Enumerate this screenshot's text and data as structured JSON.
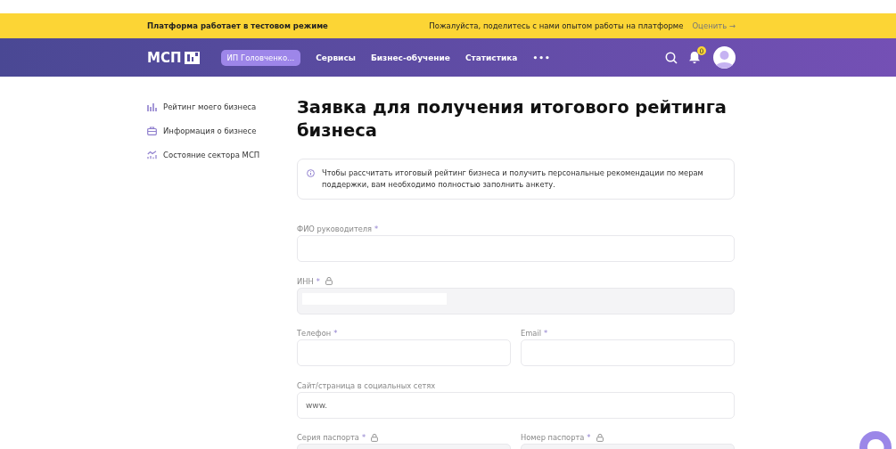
{
  "banner": {
    "text": "Платформа работает в тестовом режиме",
    "prompt": "Пожалуйста, поделитесь с нами опытом работы на платформе",
    "action": "Оценить",
    "arrow": "→"
  },
  "nav": {
    "logo": "МСП",
    "account": "ИП Головченко...",
    "links": [
      "Сервисы",
      "Бизнес-обучение",
      "Статистика"
    ],
    "more": "•••",
    "notifications": "0"
  },
  "sidebar": {
    "items": [
      {
        "label": "Рейтинг моего бизнеса"
      },
      {
        "label": "Информация о бизнесе"
      },
      {
        "label": "Состояние сектора МСП"
      }
    ]
  },
  "title": "Заявка для получения итогового рейтинга бизнеса",
  "notice": "Чтобы рассчитать итоговый рейтинг бизнеса и получить персональные рекомендации по мерам поддержки, вам необходимо полностью заполнить анкету.",
  "form": {
    "rows": [
      [
        {
          "label": "ФИО руководителя",
          "mark": "*",
          "locked": false,
          "disabled": false
        }
      ],
      [
        {
          "label": "ИНН",
          "mark": "*",
          "locked": true,
          "disabled": true,
          "redacted": true
        }
      ],
      [
        {
          "label": "Телефон",
          "mark": "*",
          "locked": false,
          "disabled": false
        },
        {
          "label": "Email",
          "mark": "*",
          "locked": false,
          "disabled": false
        }
      ],
      [
        {
          "label": "Сайт/страница в социальных сетях",
          "locked": false,
          "disabled": false,
          "placeholder": "www."
        }
      ],
      [
        {
          "label": "Серия паспорта",
          "mark": "*",
          "locked": true,
          "disabled": true
        },
        {
          "label": "Номер паспорта",
          "mark": "*",
          "locked": true,
          "disabled": true
        }
      ]
    ]
  }
}
